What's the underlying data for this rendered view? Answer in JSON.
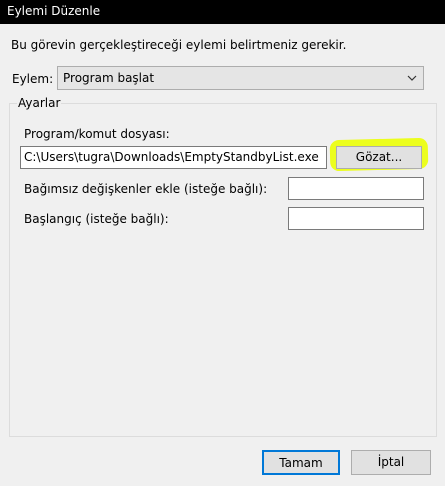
{
  "window": {
    "title": "Eylemi Düzenle"
  },
  "description": "Bu görevin gerçekleştireceği eylemi belirtmeniz gerekir.",
  "action": {
    "label": "Eylem:",
    "selected": "Program başlat",
    "chevron_icon": "chevron-down-icon"
  },
  "settings": {
    "group_label": "Ayarlar",
    "program_label": "Program/komut dosyası:",
    "program_value": "C:\\Users\\tugra\\Downloads\\EmptyStandbyList.exe",
    "browse_button": "Gözat...",
    "highlight_color": "#ebff00",
    "args_label": "Bağımsız değişkenler ekle (isteğe bağlı):",
    "args_value": "",
    "start_label": "Başlangıç (isteğe bağlı):",
    "start_value": ""
  },
  "buttons": {
    "ok": "Tamam",
    "cancel": "İptal"
  }
}
